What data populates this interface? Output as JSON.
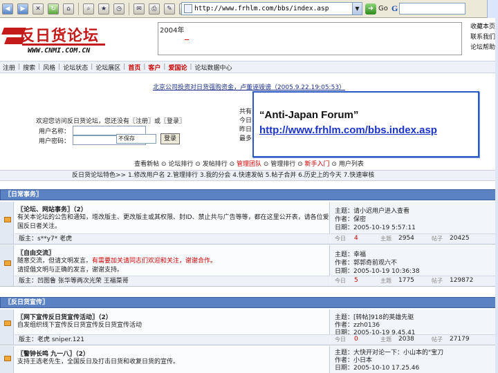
{
  "browser": {
    "url": "http://www.frhlm.com/bbs/index.asp",
    "go_label": "Go",
    "search_logo": "G"
  },
  "header": {
    "logo_title": "反日货论坛",
    "logo_sub": "WWW.CNMI.COM.CN",
    "banner_year": "2004年",
    "right_links": [
      "收藏本页",
      "联系我们",
      "论坛帮助"
    ]
  },
  "nav": {
    "items": [
      "注册",
      "搜索",
      "风格",
      "论坛状态",
      "论坛展区",
      "首页",
      "客户",
      "爱国论",
      "论坛数据中心"
    ]
  },
  "notice": {
    "text": "北京公司投资对日货强购资金，卢董诬毁谤（2005.9.22.19:05:53）"
  },
  "login": {
    "message": "欢迎您访问反日货论坛，您还没有〖注册〗或〖登录〗",
    "username_label": "用户名称：",
    "password_label": "用户密码：",
    "remember_option": "不保存",
    "login_button": "登录",
    "stats_lines": [
      "共有",
      "今日",
      "昨日",
      "最多"
    ]
  },
  "callout": {
    "title": "“Anti-Japan Forum”",
    "url": "http://www.frhlm.com/bbs.index.asp"
  },
  "util_links": {
    "items": [
      "查看新帖",
      "论坛排行",
      "发帖排行",
      "管理团队",
      "管理排行",
      "新手入门",
      "用户列表"
    ]
  },
  "features": {
    "text": "反日货论坛特色>> 1.修改用户名 2.管理排行 3.我的分会 4.快速发帖 5.帖子合并 6.历史上的今天 7.快速审核"
  },
  "sections": [
    {
      "title": "〖日常事务〗",
      "forums": [
        {
          "title": "〖论坛、网站事务〗（2）",
          "description": "有关本论坛的公告和通知，增改版主、更改版主或其权限、封ID、禁止共与广告等等，都在这里公开表，请各位爱国反日者关注。",
          "description_red": "",
          "moderator": "版主：s**y7* 老虎",
          "last_topic": "主题：请小迟用户进入查看",
          "last_author": "作者：保密",
          "last_date": "日期：2005-10-19 5:57:11",
          "today": "4",
          "topics": "2954",
          "posts": "20425"
        },
        {
          "title": "〖自由交流〗",
          "description": "随意交流，但请文明发言。",
          "description_red": "有需要加关请同志们欢迎和关注，谢谢合作。",
          "description2": "请提倡文明与正确的发言，谢谢支持。",
          "moderator": "版主：凹图鲁 张华等两次光荣 王福菜哥",
          "last_topic": "主题：幸福",
          "last_author": "作者：郭郭奇前观六不",
          "last_date": "日期：2005-10-19 10:36:38",
          "today": "5",
          "topics": "1775",
          "posts": "129872"
        }
      ]
    },
    {
      "title": "〖反日货宣传〗",
      "forums": [
        {
          "title": "〖网下宣传反日货宣传活动〗（2）",
          "description": "自发组织线下宣传反日货宣传反日货宣传活动",
          "description_red": "",
          "moderator": "版主：老虎 sniper.121",
          "last_topic": "主题：[转帖]918的英雄先驱",
          "last_author": "作者：zzh0136",
          "last_date": "日期：2005-10-19 9.45.41",
          "today": "0",
          "topics": "2038",
          "posts": "27179"
        },
        {
          "title": "〖警钟长鸣 九一八〗（2）",
          "description": "支持王选老先生，全国反日及打击日货和收复日货的宣传。",
          "description_red": "",
          "moderator": "",
          "last_topic": "主题：大快开对论一下：小山本的\"宝刀",
          "last_author": "作者：小日本",
          "last_date": "日期：2005-10-10 17.25.46",
          "today": "",
          "topics": "",
          "posts": ""
        }
      ]
    }
  ],
  "counts_labels": {
    "today": "今日",
    "topics": "主题",
    "posts": "帖子"
  },
  "colors": {
    "accent": "#cc0000",
    "section_header": "#5b82c2",
    "callout_border": "#2657c5"
  }
}
